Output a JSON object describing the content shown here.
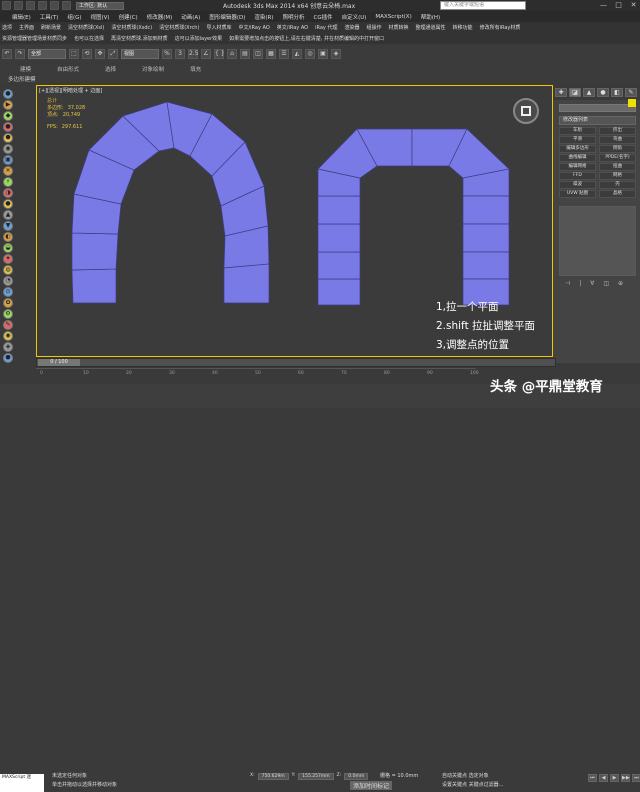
{
  "titlebar": {
    "workspace": "工作区: 默认",
    "app_title": "Autodesk 3ds Max  2014 x64      创意云朵椅.max",
    "search_placeholder": "键入关键字或短语",
    "win_min": "—",
    "win_max": "□",
    "win_close": "✕"
  },
  "menubar": [
    "编辑(E)",
    "工具(T)",
    "组(G)",
    "视图(V)",
    "创建(C)",
    "修改器(M)",
    "动画(A)",
    "图形编辑器(D)",
    "渲染(R)",
    "照明分析",
    "CG插件",
    "自定义(U)",
    "MAXScript(X)",
    "帮助(H)"
  ],
  "toolbar_row1": [
    "选项",
    "主界面",
    "刷新场景",
    "清空材质球(Xsl)",
    "清空材质球(Xsdc)",
    "清空材质球(Xrch)",
    "导入材质库",
    "中文/iRay AO",
    "英文/iRay AO",
    "iRay 代理",
    "渲染器",
    "组操作",
    "材质转换",
    "整理通道属性",
    "转移功能",
    "修改所有iRay材质"
  ],
  "toolbar_row2": [
    "资源管理器管理场景材质同步",
    "也可以在选择",
    "再清空材质球,添加到材质",
    "这可以添加layer效果",
    "如果需要增加点击的按钮上,请在右键清楚, 并在材质编辑的中打开窗口"
  ],
  "main_toolbar": {
    "undo": "↶",
    "redo": "↷",
    "select_filter": "全部",
    "view_select": "视图",
    "tools": [
      "⬚",
      "⟲",
      "✥",
      "⤢",
      "%",
      "3",
      "2.5",
      "∠",
      "{ }",
      "⌂",
      "▤",
      "◫",
      "▦",
      "☰",
      "◭",
      "◎",
      "▣",
      "◈"
    ]
  },
  "ribbon": {
    "tabs": [
      "建模",
      "自由形式",
      "选择",
      "对象绘制",
      "填充"
    ],
    "sub": "多边形建模"
  },
  "left_toolbar": {
    "icons": [
      "●",
      "▶",
      "◆",
      "●",
      "⬢",
      "◉",
      "▣",
      "✕",
      "⚡",
      "◑",
      "●",
      "▲",
      "▼",
      "◐",
      "◒",
      "✦",
      "◍",
      "◔",
      "⊙",
      "✿",
      "⚙",
      "✎",
      "◉",
      "◈",
      "⬣"
    ]
  },
  "viewport": {
    "label": "[+][透视][明暗处理 + 边面]",
    "stats": {
      "title": "总计",
      "polys_label": "多边形:",
      "polys_value": "37,028",
      "verts_label": "顶点:",
      "verts_value": "20,749",
      "fps_label": "FPS:",
      "fps_value": "297.611"
    },
    "caption": [
      "1,拉一个平面",
      "2.shift 拉扯调整平面",
      "3,调整点的位置"
    ],
    "mesh_color": "#7a7ae6",
    "edge_color": "#3d3d88"
  },
  "right_panel": {
    "tabs": [
      "✚",
      "◪",
      "▲",
      "●",
      "◧",
      "✎"
    ],
    "modifier_list": "修改器列表",
    "buttons": [
      "车削",
      "挤出",
      "平滑",
      "弯曲",
      "编辑多边形",
      "倒角",
      "曲线编辑",
      "PPDE(名字)",
      "编辑网格",
      "扭曲",
      "FFD",
      "网格",
      "噪波",
      "壳",
      "UVW 贴图",
      "晶格"
    ],
    "bottom_icons": [
      "⊣",
      "|",
      "∀",
      "◫",
      "⊕"
    ],
    "accent_color": "#f0e000"
  },
  "timeline": {
    "frame": "0 / 100"
  },
  "ruler_ticks": [
    "0",
    "10",
    "20",
    "30",
    "40",
    "50",
    "60",
    "70",
    "80",
    "90",
    "100"
  ],
  "status": {
    "maxscript": "MAXScript 迷",
    "msg1": "未选定任何对象",
    "msg2": "单击并拖动以选择并移动对象",
    "x_label": "X:",
    "x_value": "750.629m",
    "y_label": "Y:",
    "y_value": "155.257mm",
    "z_label": "Z:",
    "z_value": "0.0mm",
    "grid": "栅格 = 10.0mm",
    "add_time": "添加时间标记",
    "auto_key": "自动关键点",
    "set_key": "设置关键点",
    "selected": "选定对象",
    "key_filter": "关键点过滤器..."
  },
  "playback": [
    "⏮",
    "◀",
    "▶",
    "▶▶",
    "⏭"
  ],
  "watermark": "头条 @平鼎堂教育"
}
